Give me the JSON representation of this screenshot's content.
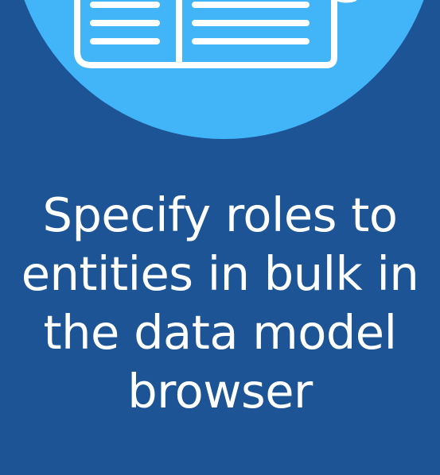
{
  "headline": {
    "lines": [
      "Specify roles to",
      "entities in bulk in",
      "the data model",
      "browser"
    ]
  },
  "icon": {
    "name": "newspaper-icon"
  },
  "colors": {
    "background": "#1d5496",
    "circle": "#41b5f8",
    "text": "#ffffff"
  }
}
